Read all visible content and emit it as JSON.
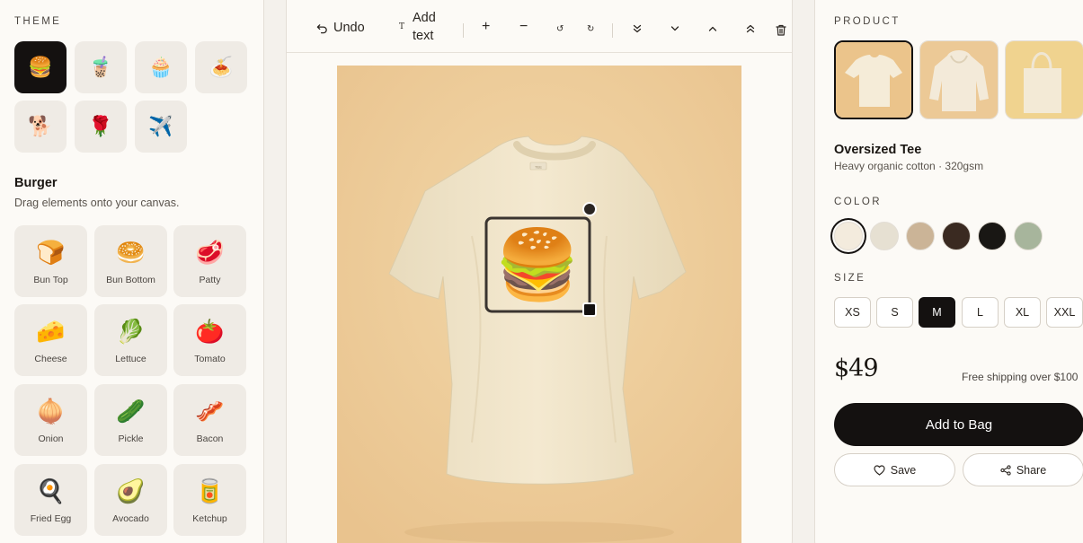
{
  "toolbar": {
    "undo": "Undo",
    "add_text_line1": "Add",
    "add_text_line2": "text",
    "text_icon": "T",
    "zoom_in": "+",
    "zoom_out": "−",
    "rotate_left": "↺",
    "rotate_right": "↻"
  },
  "theme": {
    "label": "THEME",
    "tiles": [
      {
        "emoji": "🍔",
        "active": true
      },
      {
        "emoji": "🧋"
      },
      {
        "emoji": "🧁"
      },
      {
        "emoji": "🍝"
      },
      {
        "emoji": "🐕"
      },
      {
        "emoji": "🌹"
      },
      {
        "emoji": "✈️"
      }
    ]
  },
  "category": {
    "title": "Burger",
    "subtitle": "Drag elements onto your canvas.",
    "elements": [
      {
        "label": "Bun Top",
        "emoji": "🍞"
      },
      {
        "label": "Bun Bottom",
        "emoji": "🥯"
      },
      {
        "label": "Patty",
        "emoji": "🥩"
      },
      {
        "label": "Cheese",
        "emoji": "🧀"
      },
      {
        "label": "Lettuce",
        "emoji": "🥬"
      },
      {
        "label": "Tomato",
        "emoji": "🍅"
      },
      {
        "label": "Onion",
        "emoji": "🧅"
      },
      {
        "label": "Pickle",
        "emoji": "🥒"
      },
      {
        "label": "Bacon",
        "emoji": "🥓"
      },
      {
        "label": "Fried Egg",
        "emoji": "🍳"
      },
      {
        "label": "Avocado",
        "emoji": "🥑"
      },
      {
        "label": "Ketchup",
        "emoji": "🥫"
      }
    ]
  },
  "canvas": {
    "tee_tag": "TEE",
    "placed_emoji": "🍔"
  },
  "product": {
    "label": "PRODUCT",
    "name": "Oversized Tee",
    "desc": "Heavy organic cotton · 320gsm",
    "color_label": "COLOR",
    "colors": [
      "#f3ebdd",
      "#e6e0d2",
      "#cbb497",
      "#3a2a21",
      "#191714",
      "#a7b59c"
    ],
    "size_label": "SIZE",
    "sizes": [
      "XS",
      "S",
      "M",
      "L",
      "XL",
      "XXL"
    ],
    "selected_size": "M",
    "price": "$49",
    "shipping": "Free shipping over $100",
    "add_to_bag": "Add to Bag",
    "save": "Save",
    "share": "Share"
  },
  "colors": {
    "accent_dark": "#141110",
    "canvas_bg": "#ecca96",
    "shirt": "#f2e6cc"
  }
}
